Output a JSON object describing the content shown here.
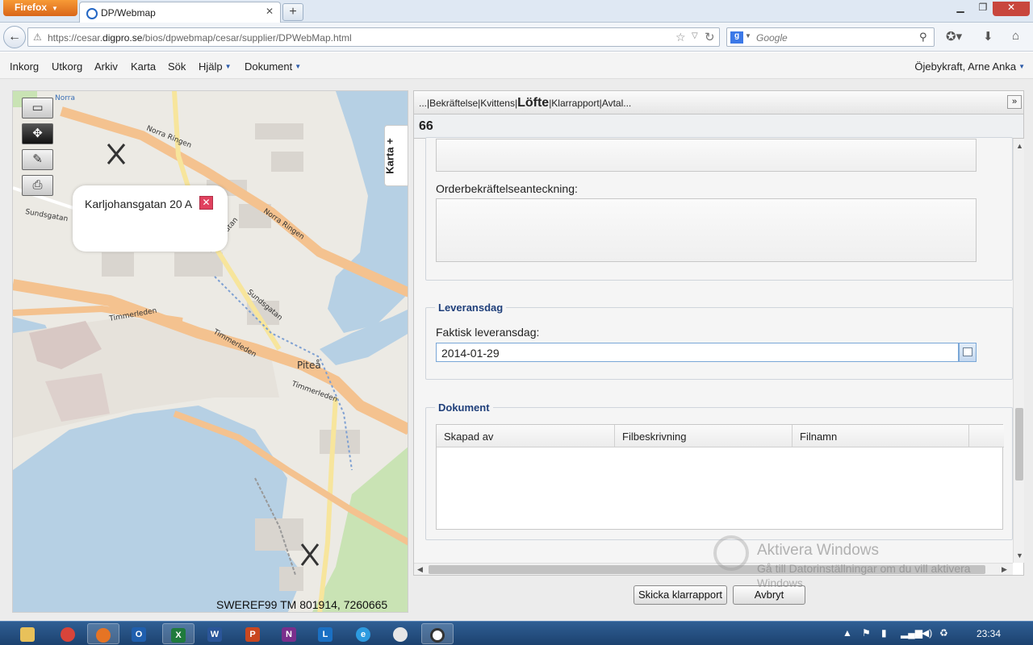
{
  "browser": {
    "firefox_button": "Firefox",
    "tab_title": "DP/Webmap",
    "new_tab": "+",
    "url_prefix": "https://cesar.",
    "url_domain": "digpro.se",
    "url_path": "/bios/dpwebmap/cesar/supplier/DPWebMap.html",
    "search_placeholder": "Google"
  },
  "app_menu": {
    "items": [
      "Inkorg",
      "Utkorg",
      "Arkiv",
      "Karta",
      "Sök",
      "Hjälp",
      "Dokument"
    ],
    "user": "Öjebykraft, Arne Anka"
  },
  "map": {
    "side_tab": "Karta +",
    "popup_text": "Karljohansgatan 20 A",
    "coordinates": "SWEREF99 TM 801914, 7260665",
    "labels": {
      "norra_ringen_1": "Norra Ringen",
      "norra_ringen_2": "Norra Ringen",
      "hamngatan": "Hamngatan",
      "sundsgatan_1": "Sundsgatan",
      "sundsgatan_2": "Sundsgatan",
      "timmerleden_1": "Timmerleden",
      "timmerleden_2": "Timmerleden",
      "timmerleden_3": "Timmerleden",
      "pitea": "Piteå",
      "norra": "Norra"
    }
  },
  "panel": {
    "breadcrumb_before": "...|Bekräftelse|Kvittens|",
    "breadcrumb_current": "Löfte",
    "breadcrumb_after": "|Klarrapport|Avtal...",
    "expand_icon": "»",
    "order_number": "66",
    "order_note_label": "Orderbekräftelseanteckning:",
    "delivery_section": "Leveransdag",
    "actual_delivery_label": "Faktisk leveransdag:",
    "actual_delivery_value": "2014-01-29",
    "documents_section": "Dokument",
    "documents_columns": [
      "Skapad av",
      "Filbeskrivning",
      "Filnamn"
    ],
    "send_button": "Skicka klarrapport",
    "cancel_button": "Avbryt"
  },
  "watermark": {
    "title": "Aktivera Windows",
    "line": "Gå till Datorinställningar om du vill aktivera Windows."
  },
  "taskbar": {
    "clock": "23:34"
  }
}
